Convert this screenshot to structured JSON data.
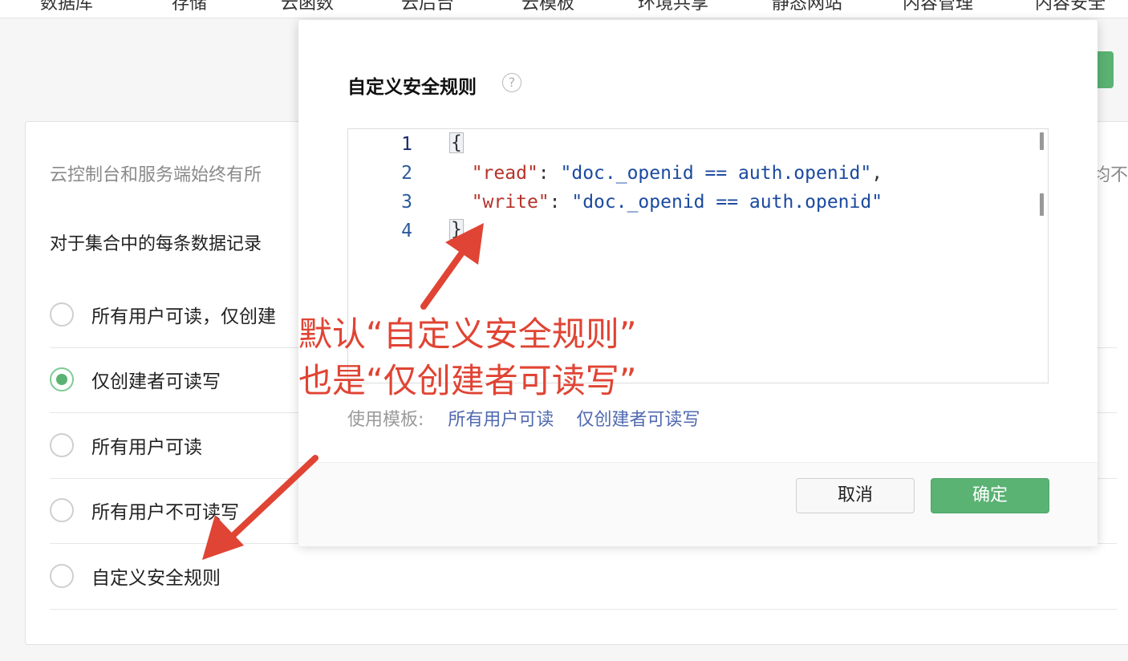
{
  "topnav": {
    "items": [
      "数据库",
      "存储",
      "云函数",
      "云后台",
      "云模板",
      "环境共享",
      "静态网站",
      "内容管理",
      "内容安全"
    ]
  },
  "card": {
    "description": "云控制台和服务端始终有所",
    "description_right": "均不",
    "subtitle": "对于集合中的每条数据记录",
    "options": [
      {
        "label": "所有用户可读，仅创建",
        "checked": false
      },
      {
        "label": "仅创建者可读写",
        "checked": true
      },
      {
        "label": "所有用户可读",
        "checked": false
      },
      {
        "label": "所有用户不可读写",
        "checked": false
      },
      {
        "label": "自定义安全规则",
        "checked": false
      }
    ]
  },
  "modal": {
    "title": "自定义安全规则",
    "help_icon": "question-circle-icon",
    "code": {
      "line_numbers": [
        "1",
        "2",
        "3",
        "4"
      ],
      "open_brace": "{",
      "line2_key": "\"read\"",
      "line2_colon": ": ",
      "line2_value": "\"doc._openid == auth.openid\"",
      "line2_comma": ",",
      "line3_key": "\"write\"",
      "line3_colon": ": ",
      "line3_value": "\"doc._openid == auth.openid\"",
      "close_brace": "}"
    },
    "templates_label": "使用模板:",
    "template_links": [
      "所有用户可读",
      "仅创建者可读写"
    ],
    "cancel_label": "取消",
    "ok_label": "确定"
  },
  "annotation": {
    "line1": "默认“自定义安全规则”",
    "line2": "也是“仅创建者可读写”"
  },
  "colors": {
    "accent_green": "#5ab273",
    "annotation_red": "#e04434",
    "link_blue": "#506ab0"
  }
}
